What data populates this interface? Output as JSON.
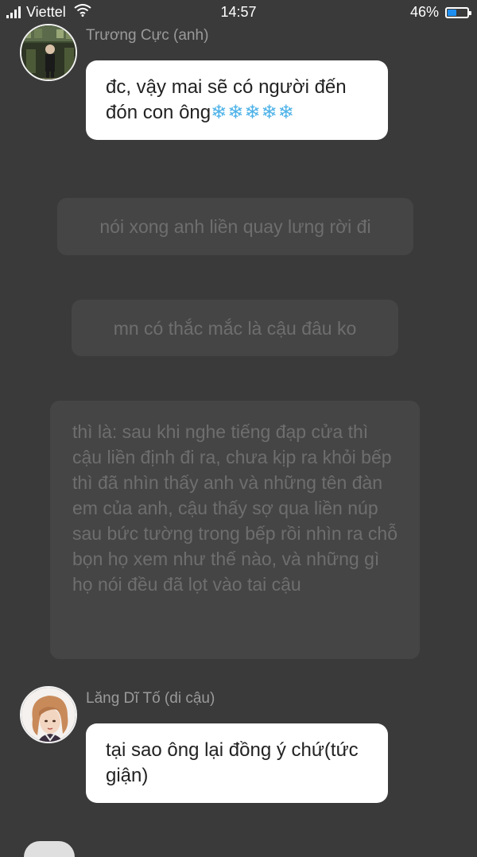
{
  "status_bar": {
    "carrier": "Viettel",
    "time": "14:57",
    "battery_percent_label": "46%",
    "battery_level": 0.46,
    "battery_color": "#1e8ff0"
  },
  "messages": [
    {
      "speaker": "Trương Cực (anh)",
      "text": "đc, vậy mai sẽ có người đến đón con ông",
      "emoji": "❄❄❄❄❄"
    },
    {
      "narration": "nói xong anh liền quay lưng rời đi"
    },
    {
      "narration": "mn có thắc mắc là cậu đâu ko"
    },
    {
      "narration": "thì là: sau khi nghe tiếng đạp cửa thì cậu liền định đi ra, chưa kịp ra khỏi bếp thì đã nhìn thấy anh và những tên đàn em của anh, cậu thấy sợ qua liền núp sau bức tường trong bếp rồi nhìn ra chỗ bọn họ xem như thế nào, và những gì họ nói đều đã lọt vào tai cậu"
    },
    {
      "speaker": "Lăng Dĩ Tố (di cậu)",
      "text": "tại sao ông lại đồng ý chứ(tức giận)"
    }
  ]
}
